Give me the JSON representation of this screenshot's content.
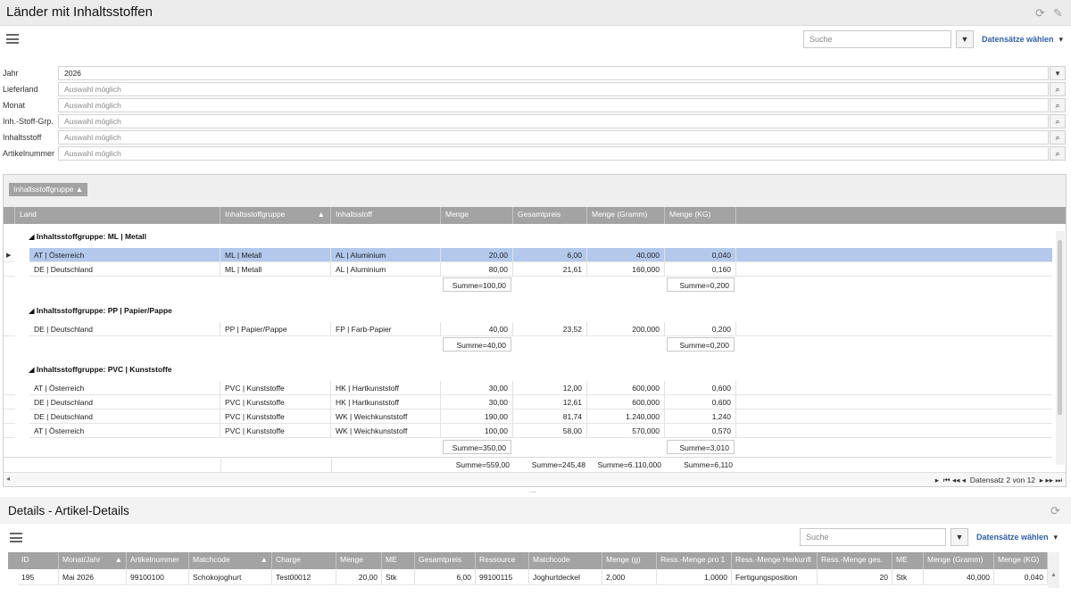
{
  "window": {
    "title": "Länder mit Inhaltsstoffen",
    "refresh_icon": "refresh-icon",
    "wrench_icon": "wrench-icon"
  },
  "toolbar": {
    "search_placeholder": "Suche",
    "records_label": "Datensätze wählen",
    "filter_icon": "filter-icon"
  },
  "filters": [
    {
      "label": "Jahr",
      "value": "2026",
      "placeholder": "",
      "kind": "dropdown"
    },
    {
      "label": "Lieferland",
      "value": "",
      "placeholder": "Auswahl möglich",
      "kind": "lookup"
    },
    {
      "label": "Monat",
      "value": "",
      "placeholder": "Auswahl möglich",
      "kind": "lookup"
    },
    {
      "label": "Inh.-Stoff-Grp.",
      "value": "",
      "placeholder": "Auswahl möglich",
      "kind": "lookup"
    },
    {
      "label": "Inhaltsstoff",
      "value": "",
      "placeholder": "Auswahl möglich",
      "kind": "lookup"
    },
    {
      "label": "Artikelnummer",
      "value": "",
      "placeholder": "Auswahl möglich",
      "kind": "lookup"
    }
  ],
  "grid": {
    "group_chip": "Inhaltsstoffgruppe",
    "columns": [
      "Land",
      "Inhaltsstoffgruppe",
      "Inhaltsstoff",
      "Menge",
      "Gesamtpreis",
      "Menge (Gramm)",
      "Menge (KG)"
    ],
    "groups": [
      {
        "header": "Inhaltsstoffgruppe: ML  |  Metall",
        "rows": [
          [
            "AT  |  Österreich",
            "ML  |  Metall",
            "AL  |  Aluminium",
            "20,00",
            "6,00",
            "40,000",
            "0,040"
          ],
          [
            "DE  |  Deutschland",
            "ML  |  Metall",
            "AL  |  Aluminium",
            "80,00",
            "21,61",
            "160,000",
            "0,160"
          ]
        ],
        "sum_menge": "Summe=100,00",
        "sum_kg": "Summe=0,200"
      },
      {
        "header": "Inhaltsstoffgruppe: PP  |  Papier/Pappe",
        "rows": [
          [
            "DE  |  Deutschland",
            "PP  |  Papier/Pappe",
            "FP  |  Farb-Papier",
            "40,00",
            "23,52",
            "200,000",
            "0,200"
          ]
        ],
        "sum_menge": "Summe=40,00",
        "sum_kg": "Summe=0,200"
      },
      {
        "header": "Inhaltsstoffgruppe: PVC  |  Kunststoffe",
        "rows": [
          [
            "AT  |  Österreich",
            "PVC  |  Kunststoffe",
            "HK  |  Hartkunststoff",
            "30,00",
            "12,00",
            "600,000",
            "0,600"
          ],
          [
            "DE  |  Deutschland",
            "PVC  |  Kunststoffe",
            "HK  |  Hartkunststoff",
            "30,00",
            "12,61",
            "600,000",
            "0,600"
          ],
          [
            "DE  |  Deutschland",
            "PVC  |  Kunststoffe",
            "WK  |  Weichkunststoff",
            "190,00",
            "81,74",
            "1.240,000",
            "1,240"
          ],
          [
            "AT  |  Österreich",
            "PVC  |  Kunststoffe",
            "WK  |  Weichkunststoff",
            "100,00",
            "58,00",
            "570,000",
            "0,570"
          ]
        ],
        "sum_menge": "Summe=350,00",
        "sum_kg": "Summe=3,010"
      }
    ],
    "totals": {
      "menge": "Summe=559,00",
      "preis": "Summe=245,48",
      "gramm": "Summe=6.110,000",
      "kg": "Summe=6,110"
    },
    "pager": "Datensatz 2 von 12",
    "splitter": "..."
  },
  "details": {
    "title": "Details - Artikel-Details",
    "search_placeholder": "Suche",
    "records_label": "Datensätze wählen",
    "columns": [
      "ID",
      "Monat/Jahr",
      "Artikelnummer",
      "Matchcode",
      "Charge",
      "Menge",
      "ME",
      "Gesamtpreis",
      "Ressource",
      "Matchcode",
      "Menge (g)",
      "Ress.-Menge pro 1",
      "Ress.-Menge Herkunft",
      "Ress.-Menge ges.",
      "ME",
      "Menge (Gramm)",
      "Menge (KG)"
    ],
    "rows": [
      [
        "195",
        "Mai 2026",
        "99100100",
        "Schokojoghurt",
        "Test00012",
        "20,00",
        "Stk",
        "6,00",
        "99100115",
        "Joghurtdeckel",
        "2,000",
        "1,0000",
        "Fertigungsposition",
        "20",
        "Stk",
        "40,000",
        "0,040"
      ]
    ]
  }
}
